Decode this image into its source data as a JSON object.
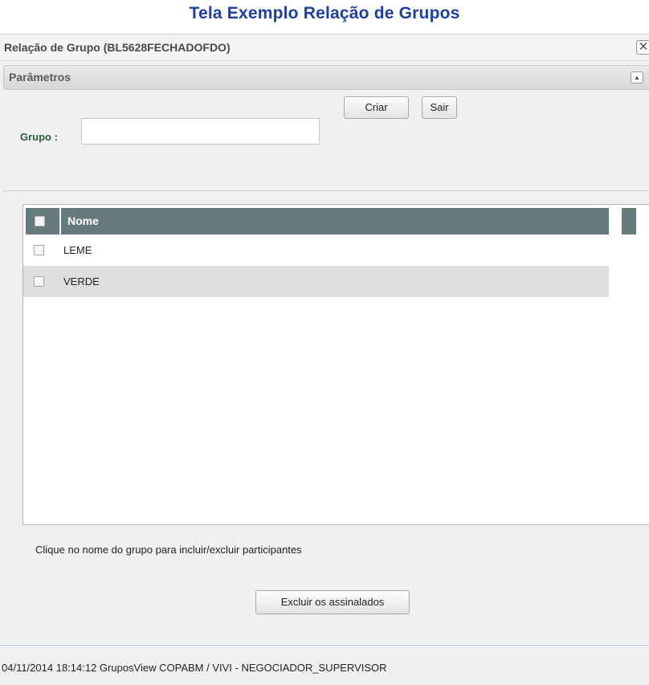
{
  "page": {
    "title": "Tela Exemplo Relação de Grupos"
  },
  "dialog": {
    "title": "Relação de Grupo (BL5628FECHADOFDO)",
    "close_glyph": "✕"
  },
  "parameters": {
    "header": "Parâmetros",
    "collapse_glyph": "▲",
    "grupo_label": "Grupo :",
    "grupo_value": "",
    "criar_label": "Criar",
    "sair_label": "Sair"
  },
  "grid": {
    "column_header": "Nome",
    "rows": [
      {
        "name": "LEME",
        "checked": false
      },
      {
        "name": "VERDE",
        "checked": false
      }
    ],
    "header_color": "#687b7c",
    "alt_row_color": "#dedede"
  },
  "hint_text": "Clique no nome do grupo para incluir/excluir participantes",
  "excluir_label": "Excluir os assinalados",
  "status_bar": "04/11/2014 18:14:12 GruposView COPABM / VIVI - NEGOCIADOR_SUPERVISOR",
  "colors": {
    "page_title": "#1f3f9c",
    "grupo_label": "#2b5c3a"
  },
  "icons": {
    "close": "close-icon",
    "collapse": "chevron-up-icon"
  }
}
